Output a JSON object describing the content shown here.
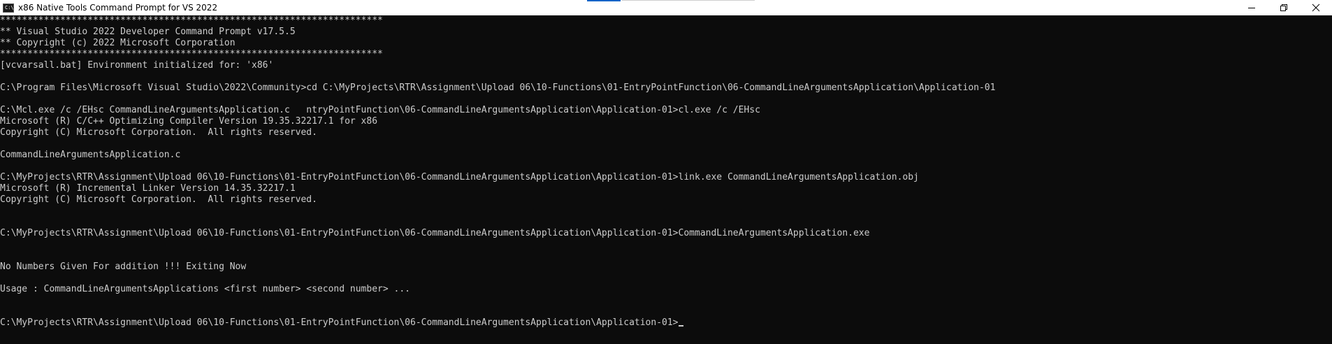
{
  "window": {
    "title": "x86 Native Tools Command Prompt for VS 2022",
    "icon_label": "C:\\"
  },
  "controls": {
    "minimize_icon": "minimize-icon",
    "restore_icon": "restore-icon",
    "close_icon": "close-icon"
  },
  "console": {
    "lines": [
      "**********************************************************************",
      "** Visual Studio 2022 Developer Command Prompt v17.5.5",
      "** Copyright (c) 2022 Microsoft Corporation",
      "**********************************************************************",
      "[vcvarsall.bat] Environment initialized for: 'x86'",
      "",
      "C:\\Program Files\\Microsoft Visual Studio\\2022\\Community>cd C:\\MyProjects\\RTR\\Assignment\\Upload 06\\10-Functions\\01-EntryPointFunction\\06-CommandLineArgumentsApplication\\Application-01",
      "",
      "C:\\Mcl.exe /c /EHsc CommandLineArgumentsApplication.c   ntryPointFunction\\06-CommandLineArgumentsApplication\\Application-01>cl.exe /c /EHsc",
      "Microsoft (R) C/C++ Optimizing Compiler Version 19.35.32217.1 for x86",
      "Copyright (C) Microsoft Corporation.  All rights reserved.",
      "",
      "CommandLineArgumentsApplication.c",
      "",
      "C:\\MyProjects\\RTR\\Assignment\\Upload 06\\10-Functions\\01-EntryPointFunction\\06-CommandLineArgumentsApplication\\Application-01>link.exe CommandLineArgumentsApplication.obj",
      "Microsoft (R) Incremental Linker Version 14.35.32217.1",
      "Copyright (C) Microsoft Corporation.  All rights reserved.",
      "",
      "",
      "C:\\MyProjects\\RTR\\Assignment\\Upload 06\\10-Functions\\01-EntryPointFunction\\06-CommandLineArgumentsApplication\\Application-01>CommandLineArgumentsApplication.exe",
      "",
      "",
      "No Numbers Given For addition !!! Exiting Now",
      "",
      "Usage : CommandLineArgumentsApplications <first number> <second number> ...",
      "",
      "",
      "C:\\MyProjects\\RTR\\Assignment\\Upload 06\\10-Functions\\01-EntryPointFunction\\06-CommandLineArgumentsApplication\\Application-01>"
    ]
  }
}
